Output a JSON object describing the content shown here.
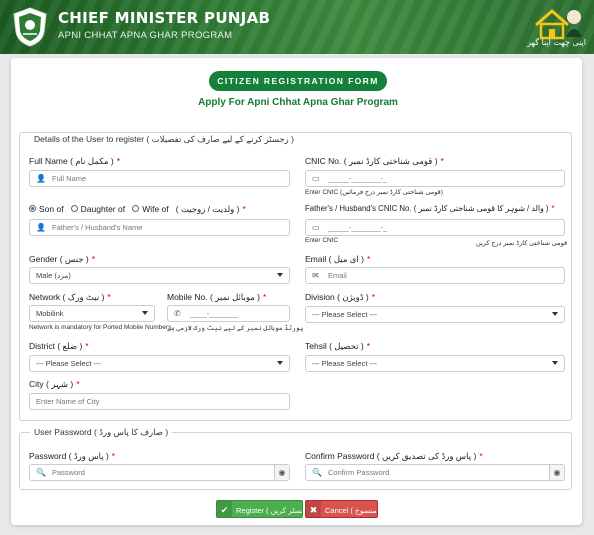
{
  "header": {
    "title": "CHIEF MINISTER PUNJAB",
    "subtitle": "APNI CHHAT APNA GHAR PROGRAM",
    "logo_urdu": "اپنی چھت اپنا گھر",
    "emblem_icon": "punjab-emblem-icon",
    "program_logo_icon": "house-logo-icon"
  },
  "form": {
    "badge": "CITIZEN REGISTRATION FORM",
    "subtitle": "Apply For Apni Chhat Apna Ghar Program"
  },
  "details": {
    "legend": "Details of the User to register ( رجسٹر کرنے کے لیے صارف کی تفصیلات )",
    "full_name": {
      "label": "Full Name ( مکمل نام )",
      "placeholder": "Full Name"
    },
    "cnic": {
      "label": "CNIC No. ( قومی شناختی کارڈ نمبر )",
      "placeholder": "_____-_______-_",
      "hint": "Enter CNIC (قومی شناختی کارڈ نمبر درج فرمائیں)"
    },
    "relation": {
      "options": [
        "Son of",
        "Daughter of",
        "Wife of"
      ],
      "urdu": "( ولدیت / زوجیت )",
      "selected": "Son of",
      "placeholder": "Father's / Husband's Name"
    },
    "father_cnic": {
      "label": "Father's / Husband's CNIC No. ( والد / شوہر کا قومی شناختی کارڈ نمبر )",
      "placeholder": "_____-_______-_",
      "hint": "Enter CNIC",
      "hint_urdu": "قومی شناختی کارڈ نمبر درج کریں"
    },
    "gender": {
      "label": "Gender ( جنس )",
      "value": "Male (مرد)"
    },
    "email": {
      "label": "Email ( ای میل )",
      "placeholder": "Email"
    },
    "network": {
      "label": "Network ( نیٹ ورک )",
      "value": "Mobilink",
      "hint": "Network is mandatory for Ported Mobile Numbers."
    },
    "mobile": {
      "label": "Mobile No. ( موبائل نمبر )",
      "placeholder": "____-_______",
      "hint": "پورٹڈ موبائل نمبر کے لیے نیٹ ورک لازمی ہے"
    },
    "division": {
      "label": "Division ( ڈویژن )",
      "value": "--- Please Select ---"
    },
    "district": {
      "label": "District ( ضلع )",
      "value": "--- Please Select ---"
    },
    "tehsil": {
      "label": "Tehsil ( تحصیل )",
      "value": "--- Please Select ---"
    },
    "city": {
      "label": "City ( شہر )",
      "placeholder": "Enter Name of City"
    }
  },
  "password_section": {
    "legend": "User Password ( صارف کا پاس ورڈ )",
    "password": {
      "label": "Password ( پاس ورڈ )",
      "placeholder": "Password"
    },
    "confirm": {
      "label": "Confirm Password ( پاس ورڈ کی تصدیق کریں )",
      "placeholder": "Confirm Password"
    }
  },
  "actions": {
    "register": "Register ( رجسٹر کریں )",
    "cancel": "Cancel ( منسوخ )"
  },
  "colors": {
    "brand_green": "#14803a",
    "header_green": "#2e7a34",
    "register": "#4cae4c",
    "cancel": "#d9534f"
  }
}
